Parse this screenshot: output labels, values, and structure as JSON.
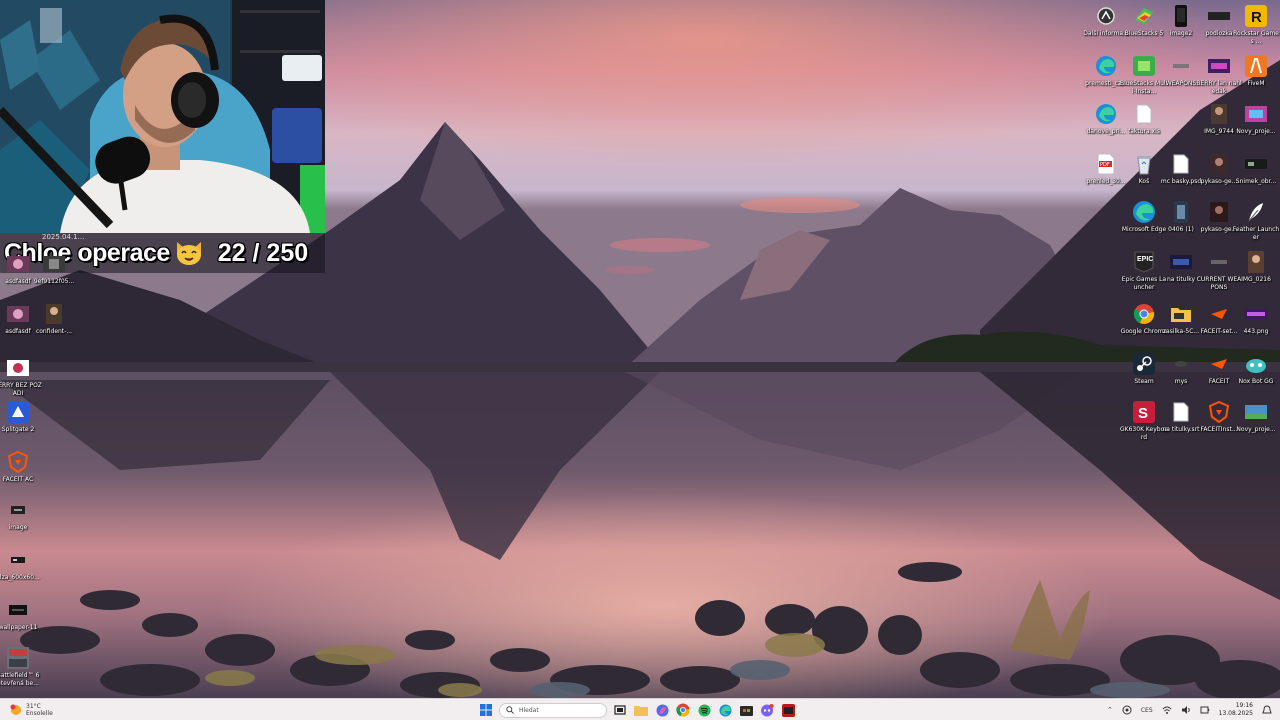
{
  "stream_overlay": {
    "cam_date": "2025.04.1...",
    "counter_name": "Chloe operace",
    "counter_value": "22 / 250"
  },
  "desktop_left": [
    {
      "label": "asdfasdf",
      "icon": "image-thumbnail"
    },
    {
      "label": "9ef9112f05...",
      "icon": "image-thumbnail"
    },
    {
      "label": "asdfasdf",
      "icon": "image-thumbnail"
    },
    {
      "label": "confident-...",
      "icon": "image-thumbnail"
    },
    {
      "label": "BERRY BEZ POZADI",
      "icon": "image-thumbnail"
    },
    {
      "label": "Splitgate 2",
      "icon": "splitgate-icon"
    },
    {
      "label": "FACEIT AC",
      "icon": "faceit-shield-icon"
    },
    {
      "label": "image",
      "icon": "image-thumbnail"
    },
    {
      "label": "alza_600x60...",
      "icon": "image-thumbnail"
    },
    {
      "label": "wallpaper-11",
      "icon": "image-thumbnail"
    },
    {
      "label": "Battlefield™ 6 otevřená be...",
      "icon": "battlefield-icon"
    }
  ],
  "desktop_right": [
    {
      "label": "Další informa...",
      "icon": "info-circle-icon"
    },
    {
      "label": "BlueStacks 5",
      "icon": "bluestacks-icon"
    },
    {
      "label": "image2",
      "icon": "image-thumbnail"
    },
    {
      "label": "podlozka",
      "icon": "image-thumbnail"
    },
    {
      "label": "Rockstar Games ...",
      "icon": "rockstar-icon"
    },
    {
      "label": "premesti_cz...",
      "icon": "edge-icon"
    },
    {
      "label": "BlueStacks Multi-Insta...",
      "icon": "bluestacks-icon"
    },
    {
      "label": "WEAPONS",
      "icon": "image-thumbnail"
    },
    {
      "label": "BERRY lan nahledak",
      "icon": "image-thumbnail"
    },
    {
      "label": "FiveM",
      "icon": "fivem-icon"
    },
    {
      "label": "danove_pri...",
      "icon": "edge-icon"
    },
    {
      "label": "faktura.xls",
      "icon": "document-icon"
    },
    {
      "label": "IMG_9744",
      "icon": "image-thumbnail"
    },
    {
      "label": "Novy_proje...",
      "icon": "image-thumbnail"
    },
    {
      "label": "prehled_30...",
      "icon": "pdf-icon"
    },
    {
      "label": "Koš",
      "icon": "recycle-bin-icon"
    },
    {
      "label": "mc basky.psd",
      "icon": "document-icon"
    },
    {
      "label": "pykaso-ge...",
      "icon": "image-thumbnail"
    },
    {
      "label": "Snimek_obr...",
      "icon": "image-thumbnail"
    },
    {
      "label": "Microsoft Edge",
      "icon": "edge-icon"
    },
    {
      "label": "0406 (1)",
      "icon": "image-thumbnail"
    },
    {
      "label": "pykaso-ge...",
      "icon": "image-thumbnail"
    },
    {
      "label": "Feather Launcher",
      "icon": "feather-icon"
    },
    {
      "label": "Epic Games Launcher",
      "icon": "epic-games-icon"
    },
    {
      "label": "na titulky",
      "icon": "image-thumbnail"
    },
    {
      "label": "CURRENT WEAPONS",
      "icon": "image-thumbnail"
    },
    {
      "label": "IMG_0216",
      "icon": "image-thumbnail"
    },
    {
      "label": "Google Chrome",
      "icon": "chrome-icon"
    },
    {
      "label": "zasilka-5C...",
      "icon": "folder-icon"
    },
    {
      "label": "FACEIT-set...",
      "icon": "faceit-icon"
    },
    {
      "label": "443.png",
      "icon": "image-thumbnail"
    },
    {
      "label": "Steam",
      "icon": "steam-icon"
    },
    {
      "label": "mys",
      "icon": "image-thumbnail"
    },
    {
      "label": "FACEIT",
      "icon": "faceit-icon"
    },
    {
      "label": "Nox Bot GG",
      "icon": "nox-icon"
    },
    {
      "label": "GK630K Keyboard",
      "icon": "keyboard-icon"
    },
    {
      "label": "na titulky.srt",
      "icon": "document-icon"
    },
    {
      "label": "FACEITInst...",
      "icon": "faceit-shield-icon"
    },
    {
      "label": "Novy_proje...",
      "icon": "image-thumbnail"
    }
  ],
  "taskbar": {
    "weather_temp": "31°C",
    "weather_desc": "Ensolelle",
    "search_placeholder": "Hledat",
    "language": "CES",
    "time": "19:16",
    "date": "13.08.2025",
    "colors": {
      "start": "#1a73e8",
      "bar": "#f2eef0"
    }
  }
}
